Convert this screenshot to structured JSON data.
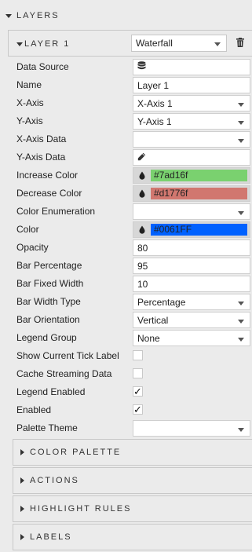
{
  "layers_header": {
    "label": "LAYERS"
  },
  "layer": {
    "title": "LAYER 1",
    "chart_type": "Waterfall"
  },
  "properties": {
    "data_source": {
      "label": "Data Source",
      "icon": "database-icon"
    },
    "name": {
      "label": "Name",
      "value": "Layer 1"
    },
    "x_axis": {
      "label": "X-Axis",
      "value": "X-Axis 1"
    },
    "y_axis": {
      "label": "Y-Axis",
      "value": "Y-Axis 1"
    },
    "x_axis_data": {
      "label": "X-Axis Data",
      "value": ""
    },
    "y_axis_data": {
      "label": "Y-Axis Data",
      "icon": "pencil-icon"
    },
    "increase_color": {
      "label": "Increase Color",
      "value": "#7ad16f",
      "color": "#7ad16f"
    },
    "decrease_color": {
      "label": "Decrease Color",
      "value": "#d1776f",
      "color": "#d1776f"
    },
    "color_enumeration": {
      "label": "Color Enumeration",
      "value": ""
    },
    "color": {
      "label": "Color",
      "value": "#0061FF",
      "color": "#0061FF"
    },
    "opacity": {
      "label": "Opacity",
      "value": "80"
    },
    "bar_percentage": {
      "label": "Bar Percentage",
      "value": "95"
    },
    "bar_fixed_width": {
      "label": "Bar Fixed Width",
      "value": "10"
    },
    "bar_width_type": {
      "label": "Bar Width Type",
      "value": "Percentage"
    },
    "bar_orientation": {
      "label": "Bar Orientation",
      "value": "Vertical"
    },
    "legend_group": {
      "label": "Legend Group",
      "value": "None"
    },
    "show_current_tick_label": {
      "label": "Show Current Tick Label",
      "checked": false
    },
    "cache_streaming_data": {
      "label": "Cache Streaming Data",
      "checked": false
    },
    "legend_enabled": {
      "label": "Legend Enabled",
      "checked": true
    },
    "enabled": {
      "label": "Enabled",
      "checked": true
    },
    "palette_theme": {
      "label": "Palette Theme",
      "value": ""
    }
  },
  "sections": [
    {
      "label": "COLOR PALETTE"
    },
    {
      "label": "ACTIONS"
    },
    {
      "label": "HIGHLIGHT RULES"
    },
    {
      "label": "LABELS"
    }
  ]
}
